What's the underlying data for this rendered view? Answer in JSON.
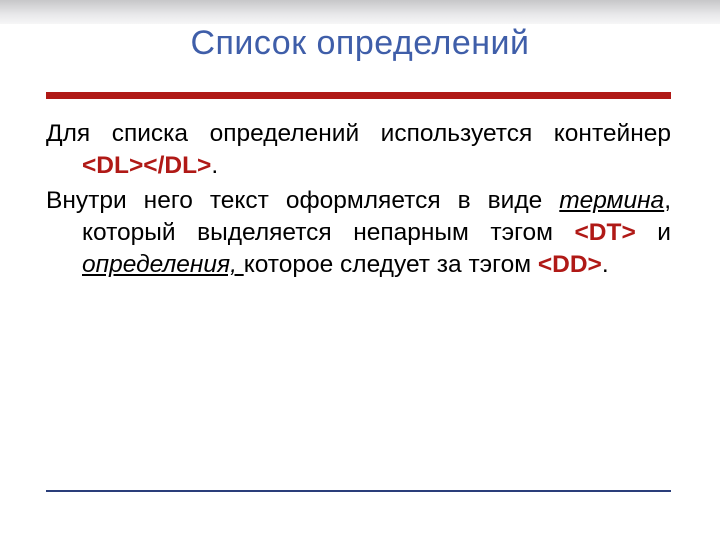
{
  "title": "Список определений",
  "para1": {
    "t1": "Для списка определений используется контейнер ",
    "tag": "<DL></DL>",
    "t2": "."
  },
  "para2": {
    "t1": "Внутри него текст оформляется в виде ",
    "term1": "термина",
    "t2": ", который выделяется непарным тэгом ",
    "tag_dt": "<DT>",
    "t3": " и ",
    "term2": "определения, ",
    "t4": "которое следует за тэгом ",
    "tag_dd": "<DD>",
    "t5": "."
  }
}
